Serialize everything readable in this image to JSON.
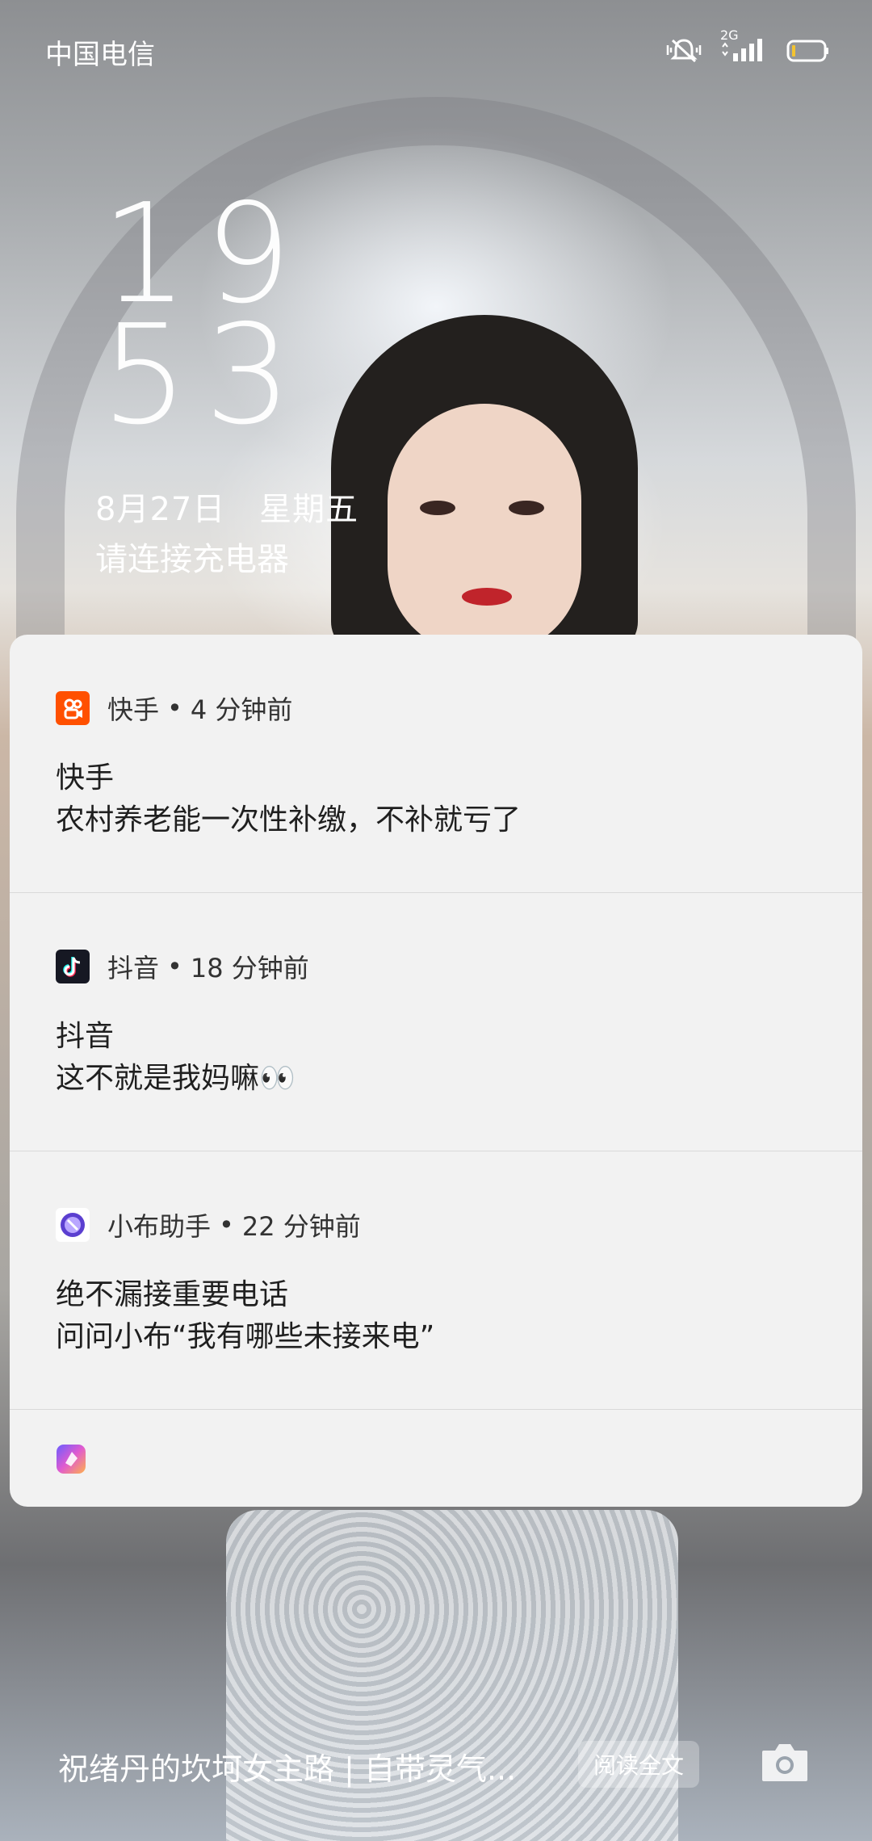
{
  "status_bar": {
    "carrier": "中国电信",
    "network_type": "2G",
    "icons": [
      "vibrate-mute-icon",
      "signal-icon",
      "battery-icon"
    ]
  },
  "lock_screen": {
    "clock_hour": "19",
    "clock_minute": "53",
    "date": "8月27日",
    "weekday": "星期五",
    "charge_prompt": "请连接充电器"
  },
  "notifications": [
    {
      "app": "快手",
      "separator": "•",
      "time": "4 分钟前",
      "title": "快手",
      "body": "农村养老能一次性补缴，不补就亏了",
      "icon": "kuaishou-icon",
      "accent": "#ff5000"
    },
    {
      "app": "抖音",
      "separator": "•",
      "time": "18 分钟前",
      "title": "抖音",
      "body": "这不就是我妈嘛👀",
      "icon": "douyin-icon",
      "accent": "#161823"
    },
    {
      "app": "小布助手",
      "separator": "•",
      "time": "22 分钟前",
      "title": "绝不漏接重要电话",
      "body": "问问小布“我有哪些未接来电”",
      "icon": "breeno-icon",
      "accent": "#6b4ad6"
    }
  ],
  "notification_footer": {
    "icon": "notification-settings-icon"
  },
  "magazine": {
    "caption": "祝绪丹的坎坷女主路 | 自带灵气...",
    "read_button": "阅读全文",
    "camera_icon": "camera-icon"
  }
}
